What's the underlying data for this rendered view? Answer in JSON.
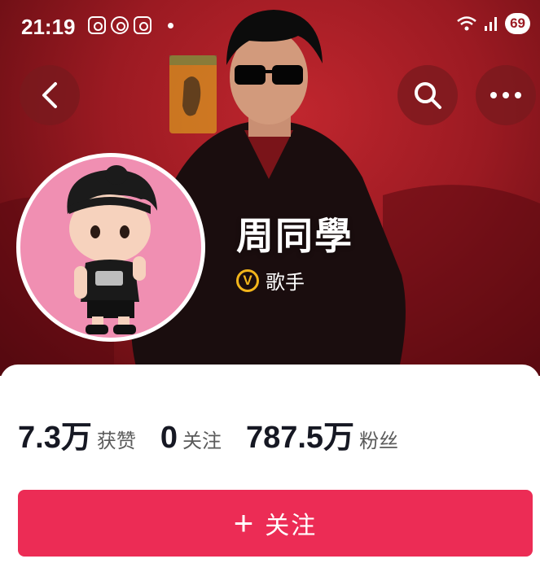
{
  "status_bar": {
    "time": "21:19",
    "battery": "69",
    "notification_icons": [
      "instagram-icon",
      "whatsapp-icon",
      "instagram-icon"
    ]
  },
  "header": {
    "back_icon": "chevron-left-icon",
    "search_icon": "search-icon",
    "more_icon": "more-horizontal-icon"
  },
  "profile": {
    "name": "周同學",
    "verified_label": "歌手",
    "verified_badge": "V"
  },
  "stats": [
    {
      "value": "7.3万",
      "label": "获赞"
    },
    {
      "value": "0",
      "label": "关注"
    },
    {
      "value": "787.5万",
      "label": "粉丝"
    }
  ],
  "follow_button": {
    "icon": "+",
    "label": "关注"
  },
  "colors": {
    "hero_red": "#9b1a22",
    "follow_button": "#ec2c55",
    "verified_gold": "#f2b51b",
    "avatar_bg": "#f08fb2"
  }
}
